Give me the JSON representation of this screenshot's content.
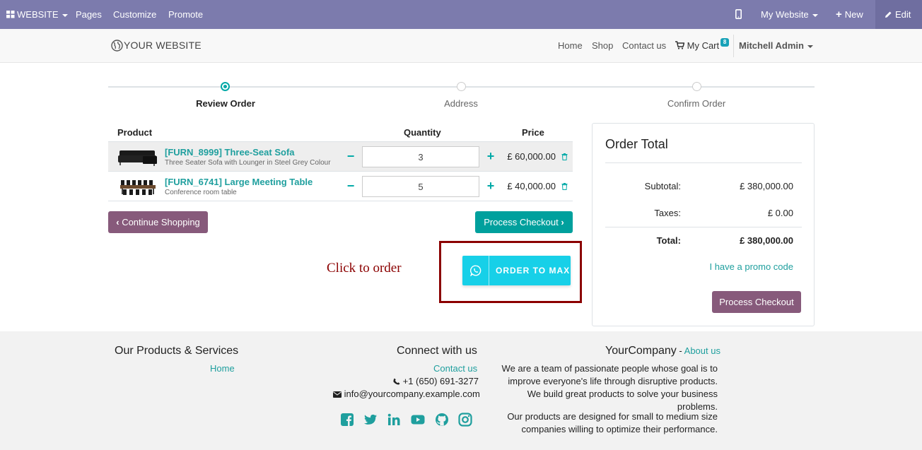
{
  "admin_bar": {
    "app_menu": "WEBSITE",
    "pages": "Pages",
    "customize": "Customize",
    "promote": "Promote",
    "website_select": "My Website",
    "new": "New",
    "edit": "Edit"
  },
  "header": {
    "logo": "YOUR WEBSITE",
    "nav": [
      "Home",
      "Shop",
      "Contact us"
    ],
    "cart_label": "My Cart",
    "cart_count": "8",
    "user": "Mitchell Admin"
  },
  "wizard": {
    "steps": [
      "Review Order",
      "Address",
      "Confirm Order"
    ],
    "active_step": 0
  },
  "cart": {
    "headers": {
      "product": "Product",
      "quantity": "Quantity",
      "price": "Price"
    },
    "rows": [
      {
        "name": "[FURN_8999] Three-Seat Sofa",
        "description": "Three Seater Sofa with Lounger in Steel Grey Colour",
        "quantity": "3",
        "price": "£ 60,000.00"
      },
      {
        "name": "[FURN_6741] Large Meeting Table",
        "description": "Conference room table",
        "quantity": "5",
        "price": "£ 40,000.00"
      }
    ],
    "continue_shopping": "Continue Shopping",
    "process_checkout": "Process Checkout"
  },
  "annotation": {
    "text": "Click to order",
    "whatsapp_button": "ORDER TO MAX"
  },
  "order_total": {
    "title": "Order Total",
    "subtotal_label": "Subtotal:",
    "subtotal": "£ 380,000.00",
    "taxes_label": "Taxes:",
    "taxes": "£ 0.00",
    "total_label": "Total:",
    "total": "£ 380,000.00",
    "promo": "I have a promo code",
    "checkout": "Process Checkout"
  },
  "footer": {
    "products_title": "Our Products & Services",
    "products_link": "Home",
    "connect_title": "Connect with us",
    "contact_link": "Contact us",
    "phone": "+1 (650) 691-3277",
    "email": "info@yourcompany.example.com",
    "company_title": "YourCompany",
    "company_sep": " - ",
    "about_link": "About us",
    "about_text_1": "We are a team of passionate people whose goal is to improve everyone's life through disruptive products. We build great products to solve your business problems.",
    "about_text_2": "Our products are designed for small to medium size companies willing to optimize their performance.",
    "social_icons": [
      "facebook-icon",
      "twitter-icon",
      "linkedin-icon",
      "youtube-icon",
      "github-icon",
      "instagram-icon"
    ]
  },
  "colors": {
    "admin_bar": "#7c7bad",
    "teal": "#00a09d",
    "purple": "#875a7b",
    "annotation": "#8b0000",
    "whatsapp_button": "#17d0e8"
  }
}
